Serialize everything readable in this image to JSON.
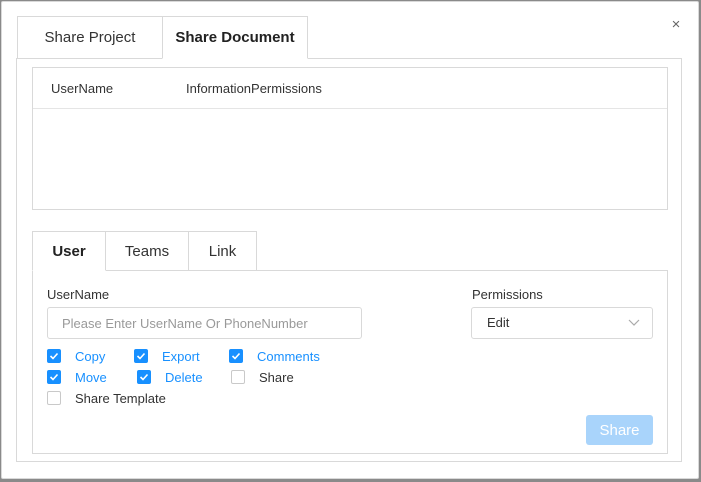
{
  "dialog": {
    "close_glyph": "×",
    "tabs": [
      {
        "label": "Share Project",
        "active": false
      },
      {
        "label": "Share Document",
        "active": true
      }
    ]
  },
  "table": {
    "columns": [
      "UserName",
      "InformationPermissions"
    ],
    "rows": []
  },
  "inner_tabs": [
    {
      "label": "User",
      "active": true
    },
    {
      "label": "Teams",
      "active": false
    },
    {
      "label": "Link",
      "active": false
    }
  ],
  "form": {
    "username_label": "UserName",
    "username_placeholder": "Please Enter UserName Or PhoneNumber",
    "username_value": "",
    "permissions_label": "Permissions",
    "permissions_value": "Edit"
  },
  "checkboxes": [
    {
      "label": "Copy",
      "checked": true
    },
    {
      "label": "Export",
      "checked": true
    },
    {
      "label": "Comments",
      "checked": true
    },
    {
      "label": "Move",
      "checked": true
    },
    {
      "label": "Delete",
      "checked": true
    },
    {
      "label": "Share",
      "checked": false
    },
    {
      "label": "Share Template",
      "checked": false
    }
  ],
  "share_button": {
    "label": "Share",
    "disabled": true
  },
  "colors": {
    "accent": "#1890ff",
    "disabled_button": "#a9d4fb",
    "border": "#d9d9d9"
  },
  "icons": {
    "close": "close-icon",
    "dropdown": "chevron-down-icon",
    "check": "check-icon"
  }
}
